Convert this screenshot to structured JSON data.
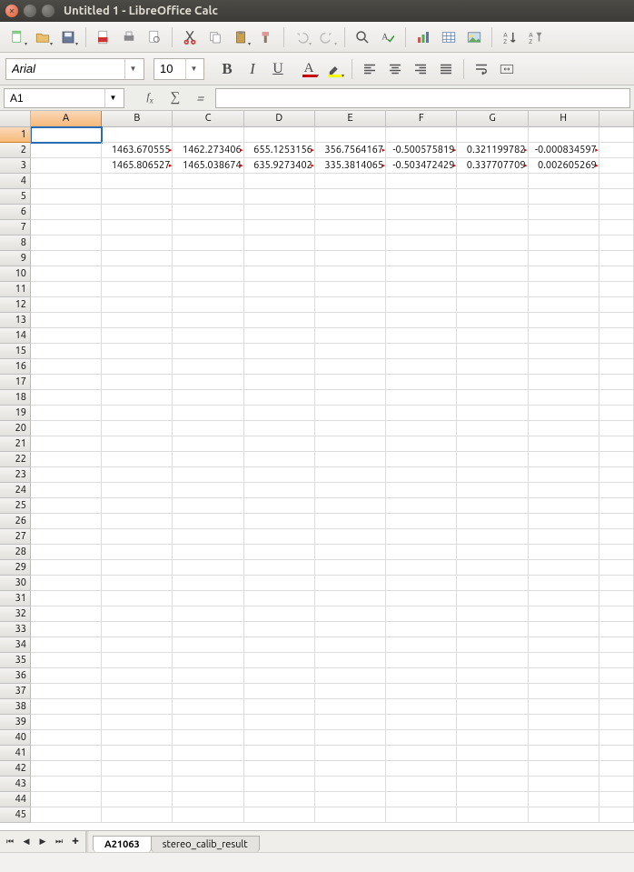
{
  "window": {
    "title": "Untitled 1 - LibreOffice Calc"
  },
  "toolbar1_icons": [
    "new-doc",
    "open-doc",
    "save-doc",
    "",
    "export-pdf",
    "print",
    "print-preview",
    "",
    "cut",
    "copy",
    "paste",
    "format-paintbrush",
    "",
    "undo",
    "redo",
    "",
    "find",
    "spellcheck",
    "",
    "insert-chart",
    "insert-table",
    "insert-image",
    "",
    "sort-asc",
    "filter"
  ],
  "formatbar": {
    "font_name": "Arial",
    "font_size": "10"
  },
  "namebox": {
    "ref": "A1"
  },
  "formula": {
    "value": ""
  },
  "columns": [
    "A",
    "B",
    "C",
    "D",
    "E",
    "F",
    "G",
    "H"
  ],
  "row_count": 45,
  "selected_cell": {
    "row": 1,
    "col": 0
  },
  "cells": {
    "2": {
      "B": "1463.670555",
      "C": "1462.273406",
      "D": "655.1253156",
      "E": "356.7564167",
      "F": "-0.500575819",
      "G": "0.321199782",
      "H": "-0.000834597"
    },
    "3": {
      "B": "1465.806527",
      "C": "1465.038674",
      "D": "635.9273402",
      "E": "335.3814065",
      "F": "-0.503472429",
      "G": "0.337707709",
      "H": "0.002605269"
    }
  },
  "truncated": {
    "2": [
      "B",
      "C",
      "D",
      "E",
      "F",
      "G",
      "H"
    ],
    "3": [
      "B",
      "C",
      "D",
      "E",
      "F",
      "G",
      "H"
    ]
  },
  "tabs": [
    {
      "name": "A21063",
      "active": true
    },
    {
      "name": "stereo_calib_result",
      "active": false
    }
  ]
}
